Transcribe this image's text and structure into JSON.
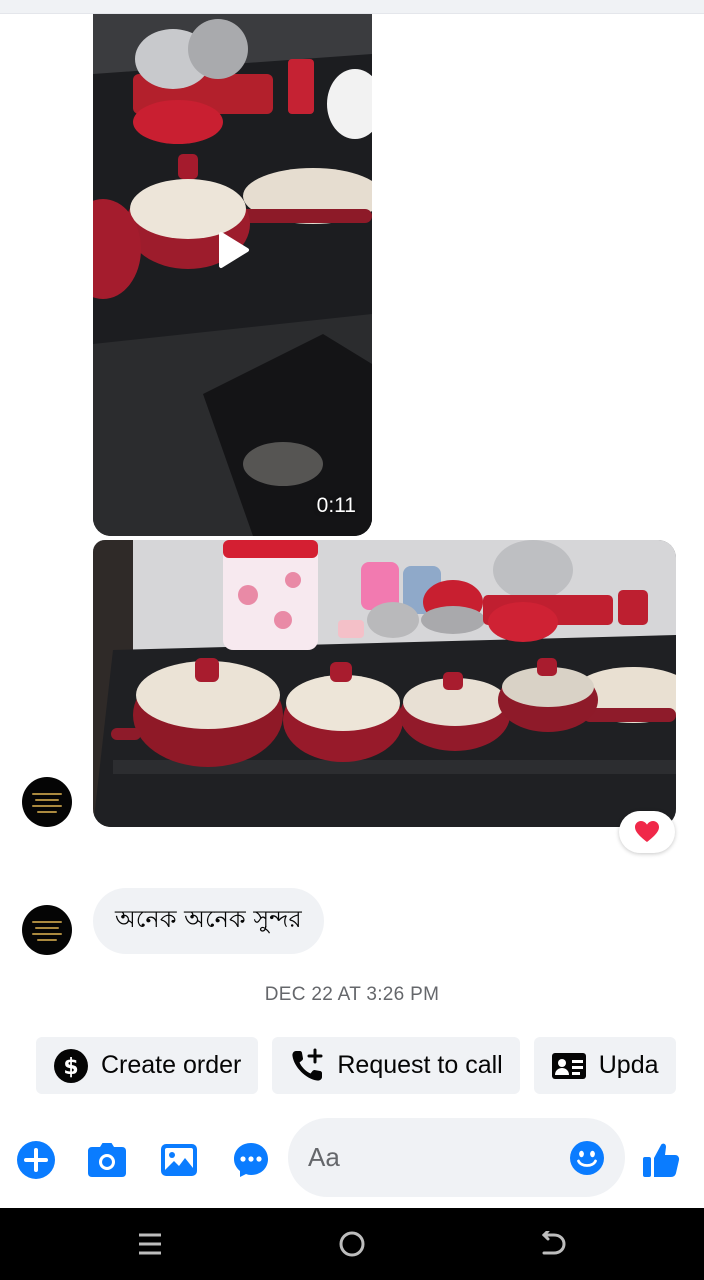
{
  "thread": {
    "video": {
      "duration": "0:11",
      "icon": "play-icon"
    },
    "photo": {
      "description_icon": "photo-cookware"
    },
    "reaction": {
      "icon": "heart-icon",
      "color": "#f02849"
    },
    "text_message": "অনেক অনেক সুন্দর",
    "timestamp": "DEC 22 AT 3:26 PM"
  },
  "quick_replies": [
    {
      "label": "Create order",
      "icon": "dollar-circle-icon"
    },
    {
      "label": "Request to call",
      "icon": "phone-add-icon"
    },
    {
      "label": "Upda",
      "icon": "contact-card-icon"
    }
  ],
  "composer": {
    "placeholder": "Aa",
    "icons": [
      "plus-icon",
      "camera-icon",
      "gallery-icon",
      "chat-bubble-icon",
      "emoji-icon",
      "thumbs-up-icon"
    ]
  },
  "navbar": {
    "icons": [
      "recents-icon",
      "home-icon",
      "back-icon"
    ]
  },
  "colors": {
    "accent": "#0a7cff",
    "bubble": "#f0f2f5",
    "muted": "#65676b",
    "pot_red": "#9e1b2c"
  }
}
